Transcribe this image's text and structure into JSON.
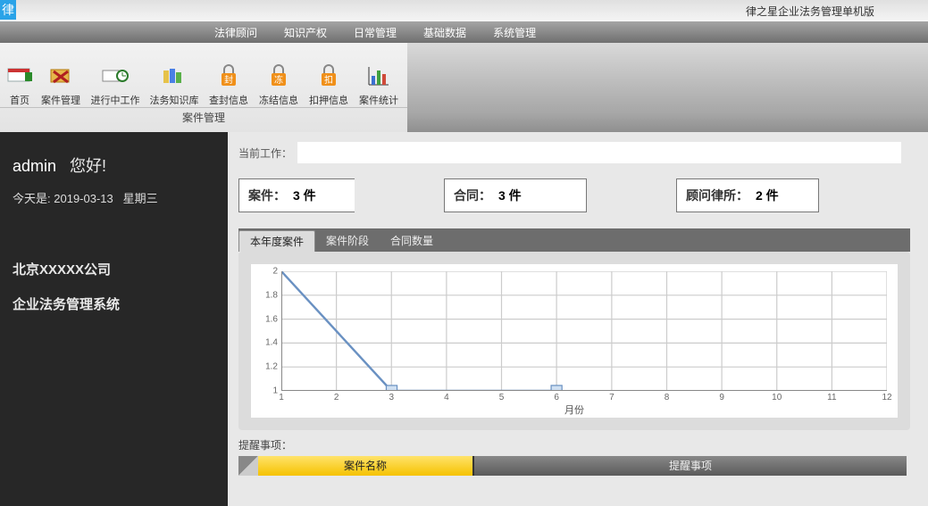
{
  "app": {
    "title": "律之星企业法务管理单机版",
    "logo_char": "律"
  },
  "menu": [
    "法律顾问",
    "知识产权",
    "日常管理",
    "基础数据",
    "系统管理"
  ],
  "toolbar_group_label": "案件管理",
  "toolbar": [
    {
      "name": "home",
      "label": "首页"
    },
    {
      "name": "cases",
      "label": "案件管理"
    },
    {
      "name": "inprogress",
      "label": "进行中工作"
    },
    {
      "name": "lawkb",
      "label": "法务知识库"
    },
    {
      "name": "seal",
      "label": "查封信息"
    },
    {
      "name": "freeze",
      "label": "冻结信息"
    },
    {
      "name": "withhold",
      "label": "扣押信息"
    },
    {
      "name": "stats",
      "label": "案件统计"
    }
  ],
  "left": {
    "user": "admin",
    "greet_suffix": "您好!",
    "today_prefix": "今天是:",
    "today_date": "2019-03-13",
    "today_dow": "星期三",
    "company": "北京XXXXX公司",
    "system": "企业法务管理系统"
  },
  "curr_work_label": "当前工作：",
  "stats": {
    "cases": {
      "label": "案件：",
      "value": "3 件"
    },
    "contracts": {
      "label": "合同：",
      "value": "3 件"
    },
    "firms": {
      "label": "顾问律所：",
      "value": "2 件"
    }
  },
  "tabs": [
    "本年度案件",
    "案件阶段",
    "合同数量"
  ],
  "chart_data": {
    "type": "line",
    "title": "",
    "xlabel": "月份",
    "ylabel": "",
    "ylim": [
      1,
      2
    ],
    "y_ticks": [
      1,
      1.2,
      1.4,
      1.6,
      1.8,
      2
    ],
    "categories": [
      1,
      2,
      3,
      4,
      5,
      6,
      7,
      8,
      9,
      10,
      11,
      12
    ],
    "values": [
      2,
      null,
      1,
      1,
      1,
      1,
      null,
      null,
      null,
      null,
      null,
      null
    ],
    "markers_at": [
      3,
      6
    ]
  },
  "reminder": {
    "section_label": "提醒事项：",
    "col1": "案件名称",
    "col2": "提醒事项"
  }
}
